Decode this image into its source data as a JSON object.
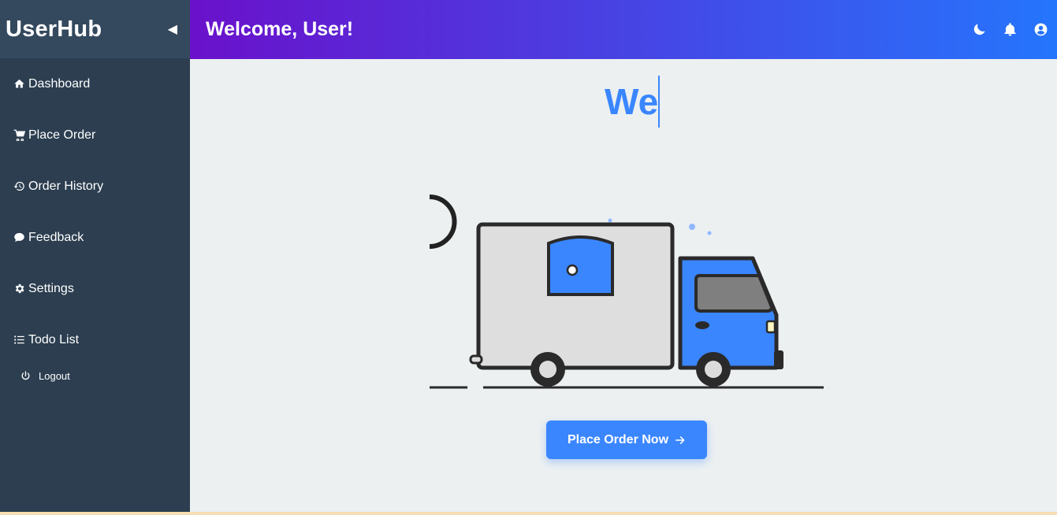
{
  "sidebar": {
    "brand": "UserHub",
    "collapse_glyph": "◀",
    "items": [
      {
        "label": "Dashboard",
        "icon": "home-icon"
      },
      {
        "label": "Place Order",
        "icon": "cart-icon"
      },
      {
        "label": "Order History",
        "icon": "history-icon"
      },
      {
        "label": "Feedback",
        "icon": "comment-icon"
      },
      {
        "label": "Settings",
        "icon": "gear-icon"
      },
      {
        "label": "Todo List",
        "icon": "list-icon"
      }
    ],
    "logout_label": "Logout"
  },
  "header": {
    "title": "Welcome, User!",
    "icons": [
      "moon-icon",
      "bell-icon",
      "user-circle-icon"
    ]
  },
  "main": {
    "typing_text": "We",
    "cta_label": "Place Order Now",
    "cta_icon": "arrow-right-icon"
  },
  "colors": {
    "sidebar_bg": "#2c3e50",
    "sidebar_header_bg": "#34495e",
    "header_gradient_start": "#6a11cb",
    "header_gradient_end": "#2575fc",
    "accent": "#3a86ff",
    "main_bg": "#ecf0f1"
  }
}
